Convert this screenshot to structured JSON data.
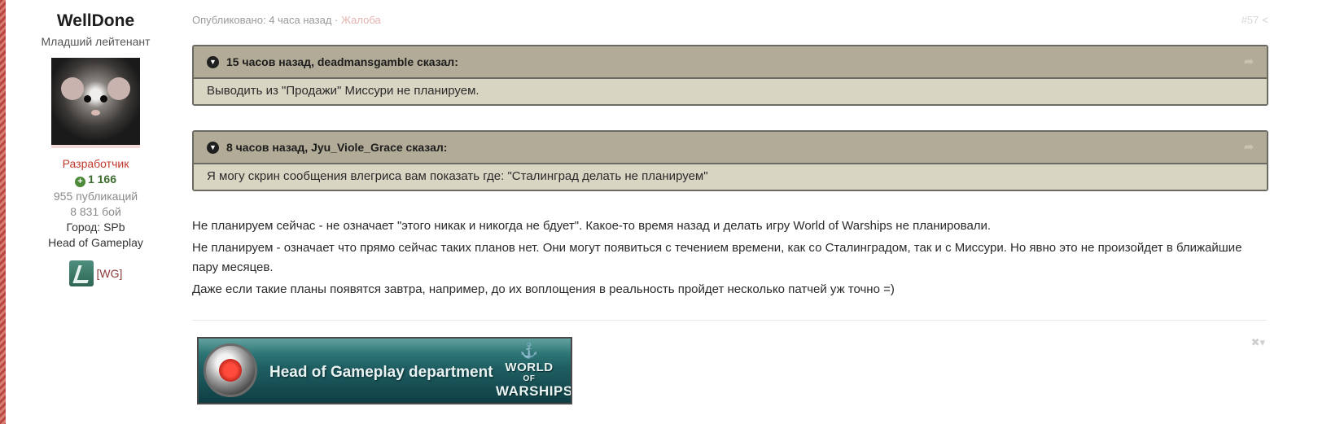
{
  "author": {
    "name": "WellDone",
    "rank": "Младший лейтенант",
    "group": "Разработчик",
    "reputation": "1 166",
    "posts": "955 публикаций",
    "battles": "8 831 бой",
    "city": "Город: SPb",
    "title": "Head of Gameplay",
    "clan_tag": "[WG]"
  },
  "post": {
    "published_label": "Опубликовано: 4 часа назад",
    "separator": " · ",
    "report_label": "Жалоба",
    "post_number": "#57"
  },
  "quotes": [
    {
      "header": "15 часов назад, deadmansgamble сказал:",
      "text": "Выводить из \"Продажи\" Миссури не планируем."
    },
    {
      "header": "8 часов назад, Jyu_Viole_Grace сказал:",
      "text": "Я могу скрин сообщения влегриса вам показать где: \"Сталинград делать не планируем\""
    }
  ],
  "content": {
    "paragraphs": [
      "Не планируем сейчас - не означает \"этого никак и никогда не бдует\". Какое-то время назад и делать игру World of Warships не планировали.",
      "Не планируем - означает что прямо сейчас таких планов нет. Они могут появиться с течением времени, как со Сталинградом, так и с Миссури. Но явно это не произойдет в ближайшие пару месяцев.",
      "Даже если такие планы появятся завтра, например, до их воплощения в реальность пройдет несколько патчей уж точно =)"
    ]
  },
  "signature": {
    "banner_title": "Head of Gameplay department",
    "logo_line1": "WORLD",
    "logo_line2": "OF",
    "logo_line3": "WARSHIPS"
  },
  "icons": {
    "reputation": "plus-circle-icon",
    "quote_toggle": "chevron-down-circle-icon",
    "quote_jump": "share-arrow-icon",
    "post_share": "share-icon",
    "signature_close": "close-icon"
  },
  "colors": {
    "group": "#c0392b",
    "reputation": "#3b6d2e",
    "quote_header": "#b1ab97",
    "quote_body": "#d8d5c3",
    "report_link": "#e3b3b0"
  }
}
